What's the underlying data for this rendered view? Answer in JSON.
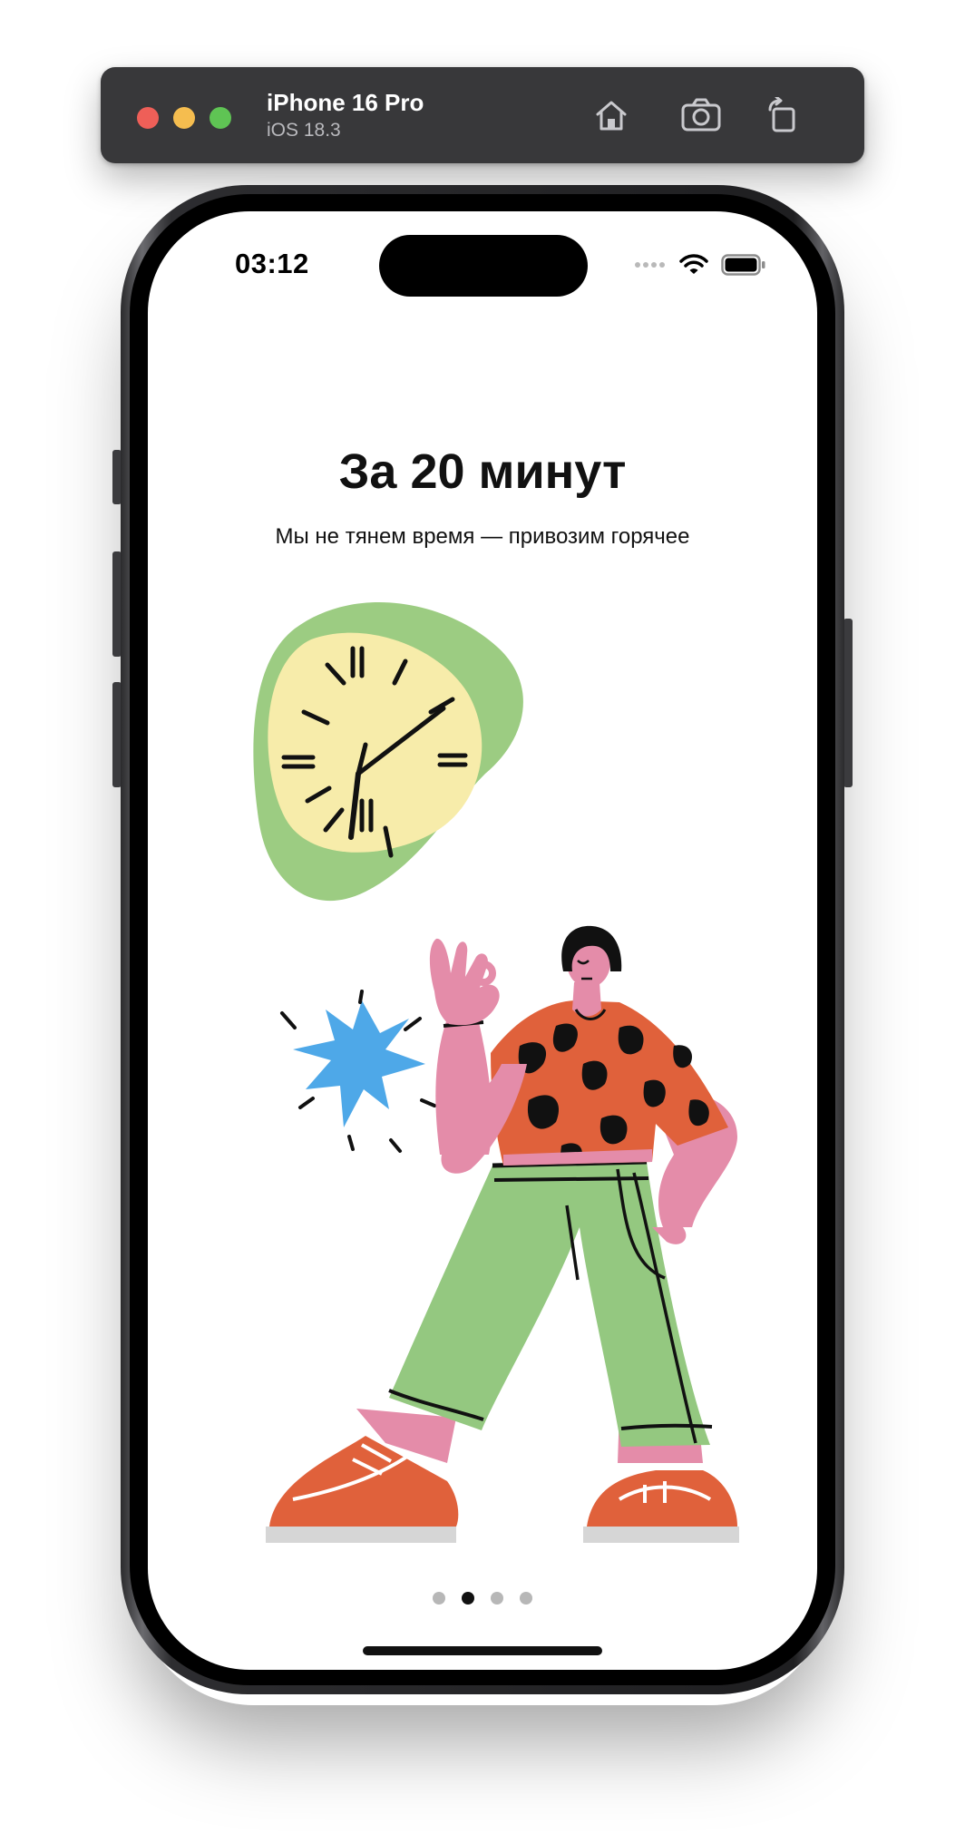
{
  "simulator": {
    "device_name": "iPhone 16 Pro",
    "os_version": "iOS 18.3",
    "toolbar": [
      {
        "name": "home-icon",
        "label": "Home"
      },
      {
        "name": "camera-icon",
        "label": "Screenshot"
      },
      {
        "name": "rotate-icon",
        "label": "Rotate"
      }
    ]
  },
  "status_bar": {
    "time": "03:12",
    "icons": [
      "signal-dots-icon",
      "wifi-icon",
      "battery-icon"
    ]
  },
  "onboarding": {
    "title": "За 20 минут",
    "subtitle": "Мы не тянем время — привозим горячее",
    "illustration": "woman-with-clock-ok-gesture",
    "pager": {
      "count": 4,
      "active_index": 1
    }
  },
  "colors": {
    "sim_bar": "#38383a",
    "blob_green": "#9ccc82",
    "clock_face": "#f7ecaa",
    "shirt_orange": "#e0613b",
    "skin_pink": "#e48ca9",
    "pants_green": "#94c880",
    "shoe_orange": "#e0613b",
    "burst_blue": "#4ea8e8",
    "text": "#111111"
  }
}
